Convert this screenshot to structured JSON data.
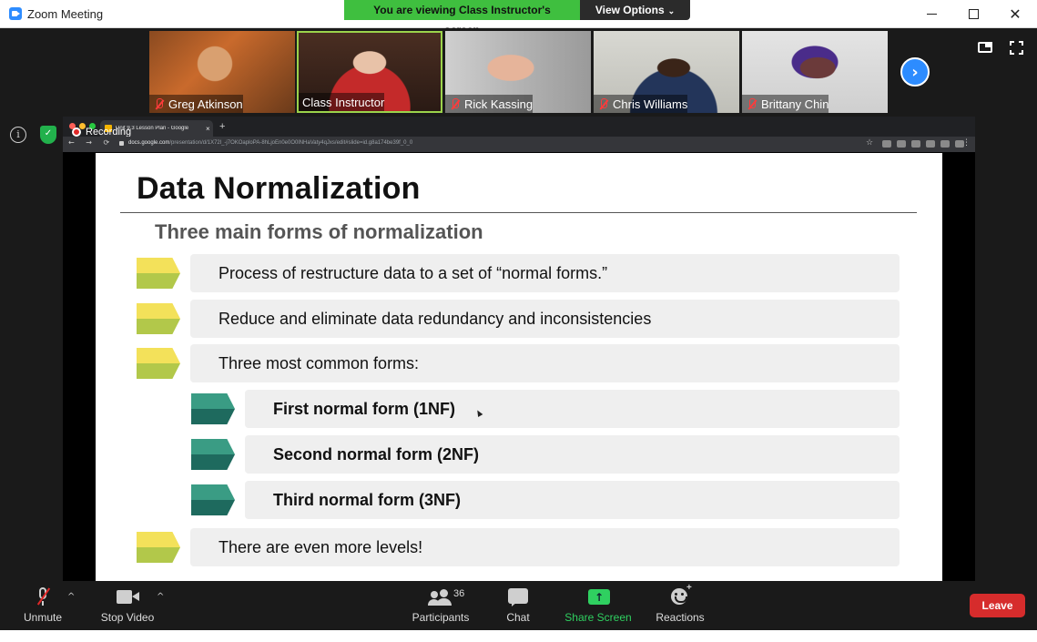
{
  "window": {
    "title": "Zoom Meeting",
    "minimize_glyph": "",
    "maximize_glyph": "",
    "close_glyph": "✕"
  },
  "share_banner": {
    "text": "You are viewing Class Instructor's screen",
    "view_options_label": "View Options",
    "view_options_caret": "⌄"
  },
  "participants_strip": {
    "tiles": [
      {
        "name": "Greg Atkinson",
        "muted": true,
        "active_speaker": false
      },
      {
        "name": "Class Instructor",
        "muted": false,
        "active_speaker": true
      },
      {
        "name": "Rick Kassing",
        "muted": true,
        "active_speaker": false
      },
      {
        "name": "Chris Williams",
        "muted": true,
        "active_speaker": false
      },
      {
        "name": "Brittany Chin",
        "muted": true,
        "active_speaker": false
      }
    ],
    "next_glyph": "›",
    "active_border_color": "#9bd34b"
  },
  "side_icons": {
    "info_glyph": "i",
    "shield_glyph": "✓"
  },
  "browser": {
    "tab_title": "Unit 9.3 Lesson Plan - Google",
    "tab_close_glyph": "×",
    "new_tab_glyph": "+",
    "recording_label": "Recording",
    "nav_glyphs": "← → ⟳",
    "url_domain": "docs.google.com",
    "url_path": "/presentation/d/1X72l_-j7OKOaploPA-8hLjoEn0e0O0lNHaVaty4qJxs/edit#slide=id.g8a174be39f_0_0",
    "bookmark_glyph": "☆",
    "menu_glyph": "⋮"
  },
  "slide": {
    "title": "Data Normalization",
    "subtitle": "Three main forms of normalization",
    "bullets": [
      {
        "text": "Process of restructure data to a set of “normal forms.”",
        "level": 1,
        "bold": false,
        "arrow_color": "yellow-green"
      },
      {
        "text": "Reduce and eliminate data redundancy and inconsistencies",
        "level": 1,
        "bold": false,
        "arrow_color": "yellow-green"
      },
      {
        "text": "Three most common forms:",
        "level": 1,
        "bold": false,
        "arrow_color": "yellow-green"
      },
      {
        "text": "First normal form (1NF)",
        "level": 2,
        "bold": true,
        "arrow_color": "teal"
      },
      {
        "text": "Second normal form (2NF)",
        "level": 2,
        "bold": true,
        "arrow_color": "teal"
      },
      {
        "text": "Third normal form (3NF)",
        "level": 2,
        "bold": true,
        "arrow_color": "teal"
      },
      {
        "text": "There are even more levels!",
        "level": 1,
        "bold": false,
        "arrow_color": "yellow-green"
      }
    ]
  },
  "toolbar": {
    "unmute_label": "Unmute",
    "unmute_caret": "^",
    "stop_video_label": "Stop Video",
    "stop_video_caret": "^",
    "participants_label": "Participants",
    "participants_count": "36",
    "chat_label": "Chat",
    "share_screen_label": "Share Screen",
    "share_screen_glyph": "↑",
    "reactions_label": "Reactions",
    "reactions_plus": "+",
    "leave_label": "Leave"
  },
  "colors": {
    "zoom_blue": "#2d8cff",
    "share_green": "#3fbf3f",
    "leave_red": "#d62c2c",
    "toolbar_bg": "#1a1a1a"
  }
}
